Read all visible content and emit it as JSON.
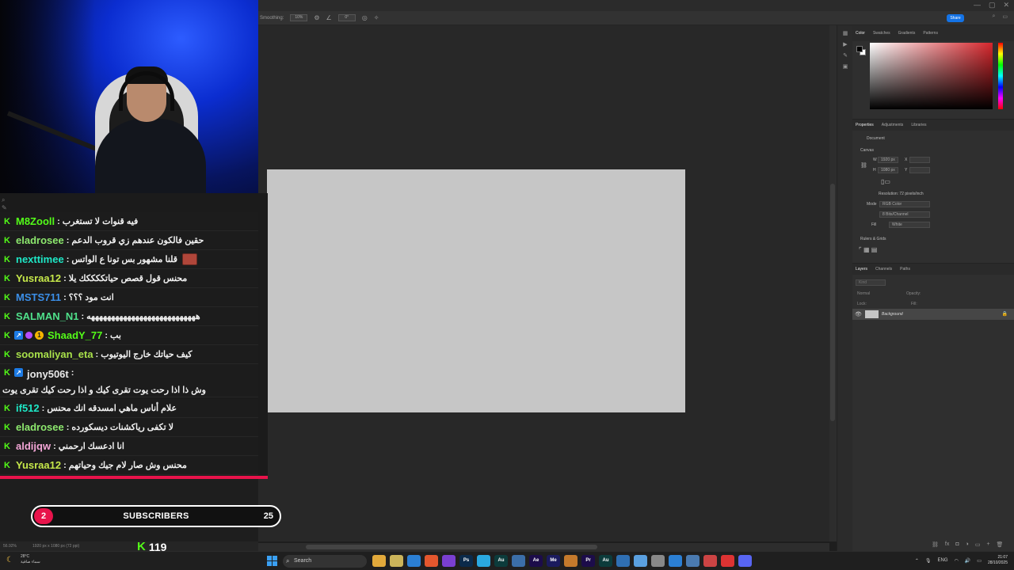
{
  "photoshop": {
    "options": {
      "smoothing_label": "Smoothing:",
      "smoothing_value": "10%",
      "angle_value": "0°"
    },
    "share_label": "Share",
    "color_panel": {
      "tabs": [
        "Color",
        "Swatches",
        "Gradients",
        "Patterns"
      ],
      "active_color": "#d6262c"
    },
    "properties": {
      "tabs": [
        "Properties",
        "Adjustments",
        "Libraries"
      ],
      "document_label": "Document",
      "canvas_label": "Canvas",
      "width_label": "W",
      "width_value": "1920 px",
      "height_label": "H",
      "height_value": "1080 px",
      "x_label": "X",
      "y_label": "Y",
      "resolution": "Resolution: 72 pixels/inch",
      "mode_label": "Mode",
      "mode_value": "RGB Color",
      "depth_value": "8 Bits/Channel",
      "fill_label": "Fill",
      "fill_value": "White",
      "rulers_label": "Rulers & Grids"
    },
    "layers": {
      "tabs": [
        "Layers",
        "Channels",
        "Paths"
      ],
      "kind_placeholder": "Kind",
      "blend_mode": "Normal",
      "opacity_label": "Opacity:",
      "lock_label": "Lock:",
      "fill_label": "Fill:",
      "layer_name": "Background"
    },
    "status": {
      "zoom": "56.92%",
      "doc_size": "1920 px x 1080 px (72 ppi)"
    }
  },
  "chat": {
    "messages": [
      {
        "user": "M8Zooll",
        "color": "#53fc18",
        "text": "فيه قنوات لا تستغرب",
        "badges": []
      },
      {
        "user": "eladrosee",
        "color": "#8de86e",
        "text": "حقين فالكون عندهم زي قروب الدعم",
        "badges": []
      },
      {
        "user": "nexttimee",
        "color": "#1ee8c7",
        "text": "قلنا مشهور بس تونا ع الواتس",
        "badges": [],
        "emote": true
      },
      {
        "user": "Yusraa12",
        "color": "#c6e84a",
        "text": "محنس قول قصص حياتككككك يلا",
        "badges": []
      },
      {
        "user": "MSTS711",
        "color": "#3b8fe8",
        "text": "انت مود ؟؟؟",
        "badges": []
      },
      {
        "user": "SALMAN_N1",
        "color": "#4fe08a",
        "text": "هههههههههههههههههههههههههههه",
        "badges": []
      },
      {
        "user": "ShaadY_77",
        "color": "#53fc18",
        "text": "بب",
        "badges": [
          "sub",
          "gem",
          "one"
        ]
      },
      {
        "user": "soomaliyan_eta",
        "color": "#a8e04a",
        "text": "كيف حياتك خارج اليوتيوب",
        "badges": []
      },
      {
        "user": "jony506t",
        "color": "#e8e8e8",
        "text": "وش ذا اذا رحت يوت تقرى كيك و اذا رحت كيك تقرى يوت",
        "badges": [
          "sub"
        ],
        "tall": true
      },
      {
        "user": "if512",
        "color": "#1ee8c7",
        "text": "علام أناس ماهي امسدقه انك محنس",
        "badges": []
      },
      {
        "user": "eladrosee",
        "color": "#8de86e",
        "text": "لا تكفى رياكشنات ديسكورده",
        "badges": []
      },
      {
        "user": "aldijqw",
        "color": "#f4a6d7",
        "text": "انا ادعسك ارحمني",
        "badges": []
      },
      {
        "user": "Yusraa12",
        "color": "#c6e84a",
        "text": "محنس وش صار لام جيك وحياتهم",
        "badges": []
      }
    ]
  },
  "subgoal": {
    "count": "2",
    "label": "SUBSCRIBERS",
    "goal": "25"
  },
  "viewers": {
    "count": "119"
  },
  "taskbar": {
    "weather_temp": "28°C",
    "weather_desc": "سماء صافية",
    "search_placeholder": "Search",
    "lang": "ENG",
    "time": "21:07",
    "date": "28/10/2025",
    "apps": [
      {
        "label": "",
        "color": "#e2a93b"
      },
      {
        "label": "",
        "color": "#cbb45a"
      },
      {
        "label": "",
        "color": "#2b7fd4"
      },
      {
        "label": "",
        "color": "#e4572e"
      },
      {
        "label": "",
        "color": "#7a3fd1"
      },
      {
        "label": "Ps",
        "color": "#0b2a4a"
      },
      {
        "label": "",
        "color": "#2aa8e0"
      },
      {
        "label": "Au",
        "color": "#0c3b3b"
      },
      {
        "label": "",
        "color": "#3b6ea8"
      },
      {
        "label": "Ae",
        "color": "#1c0c4a"
      },
      {
        "label": "Me",
        "color": "#1b1b5e"
      },
      {
        "label": "",
        "color": "#c47a2c"
      },
      {
        "label": "Pr",
        "color": "#1c0c4a"
      },
      {
        "label": "Au",
        "color": "#0c3b3b"
      },
      {
        "label": "",
        "color": "#2f6fb3"
      },
      {
        "label": "",
        "color": "#5aa0e0"
      },
      {
        "label": "",
        "color": "#888888"
      },
      {
        "label": "",
        "color": "#2b7fd4"
      },
      {
        "label": "",
        "color": "#4a7ab0"
      },
      {
        "label": "",
        "color": "#c44"
      },
      {
        "label": "",
        "color": "#d33"
      },
      {
        "label": "",
        "color": "#5865f2"
      }
    ]
  }
}
